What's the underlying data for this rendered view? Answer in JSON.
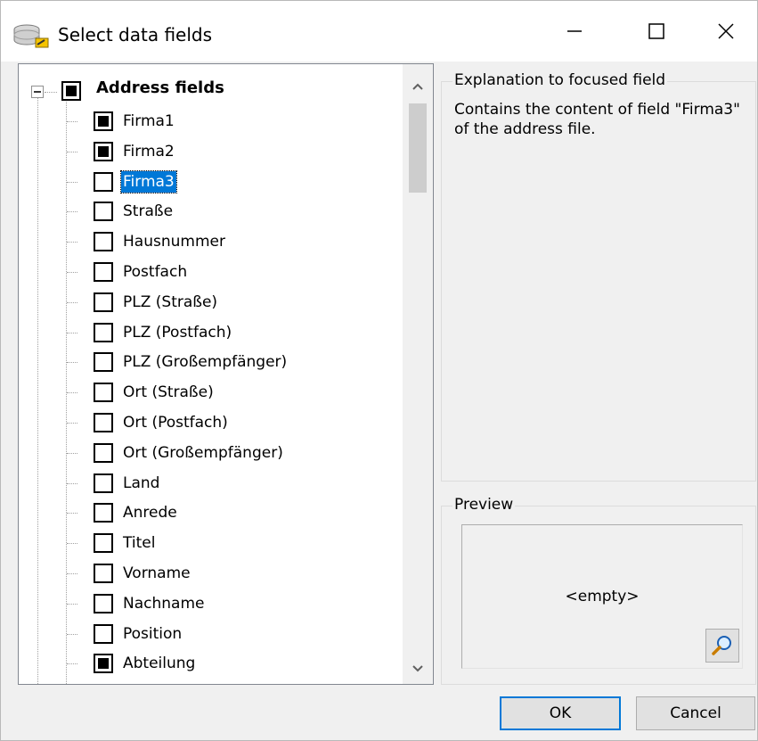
{
  "window": {
    "title": "Select data fields",
    "icon": "database-edit-icon",
    "controls": {
      "minimize": "—",
      "maximize": "☐",
      "close": "✕"
    }
  },
  "tree": {
    "root": {
      "label": "Address fields",
      "checked": true,
      "expanded": true
    },
    "items": [
      {
        "label": "Firma1",
        "checked": true
      },
      {
        "label": "Firma2",
        "checked": true
      },
      {
        "label": "Firma3",
        "checked": false,
        "selected": true
      },
      {
        "label": "Straße",
        "checked": false
      },
      {
        "label": "Hausnummer",
        "checked": false
      },
      {
        "label": "Postfach",
        "checked": false
      },
      {
        "label": "PLZ (Straße)",
        "checked": false
      },
      {
        "label": "PLZ (Postfach)",
        "checked": false
      },
      {
        "label": "PLZ (Großempfänger)",
        "checked": false
      },
      {
        "label": "Ort (Straße)",
        "checked": false
      },
      {
        "label": "Ort (Postfach)",
        "checked": false
      },
      {
        "label": "Ort (Großempfänger)",
        "checked": false
      },
      {
        "label": "Land",
        "checked": false
      },
      {
        "label": "Anrede",
        "checked": false
      },
      {
        "label": "Titel",
        "checked": false
      },
      {
        "label": "Vorname",
        "checked": false
      },
      {
        "label": "Nachname",
        "checked": false
      },
      {
        "label": "Position",
        "checked": false
      },
      {
        "label": "Abteilung",
        "checked": true
      },
      {
        "label": "",
        "checked": true
      }
    ]
  },
  "explanation": {
    "title": "Explanation to focused field",
    "text": "Contains the content of field \"Firma3\" of the address file."
  },
  "preview": {
    "title": "Preview",
    "value": "<empty>",
    "zoom_icon": "magnifier-icon"
  },
  "buttons": {
    "ok": "OK",
    "cancel": "Cancel"
  },
  "colors": {
    "selection": "#0078d7",
    "default_button_border": "#0078d7"
  }
}
